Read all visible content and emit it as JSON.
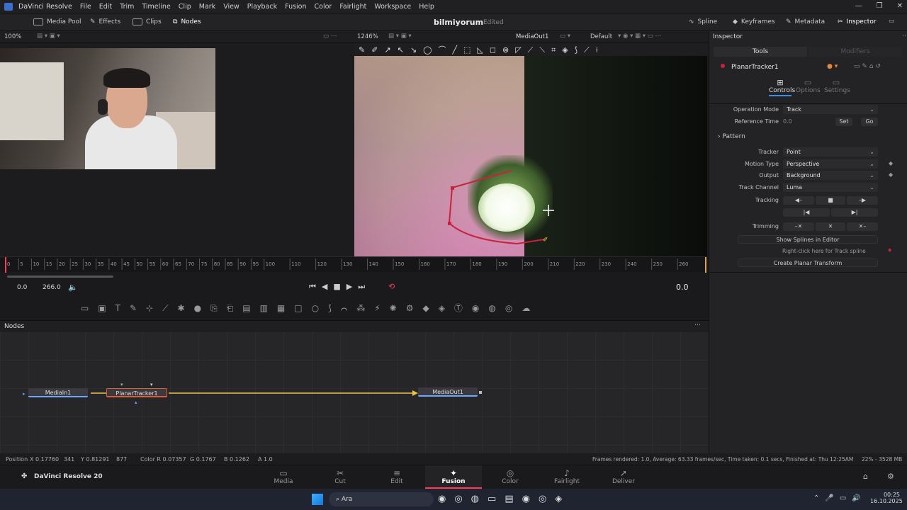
{
  "app": {
    "title": "DaVinci Resolve",
    "menu": [
      "File",
      "Edit",
      "Trim",
      "Timeline",
      "Clip",
      "Mark",
      "View",
      "Playback",
      "Fusion",
      "Color",
      "Fairlight",
      "Workspace",
      "Help"
    ]
  },
  "toolbar": {
    "media_pool": "Media Pool",
    "effects": "Effects",
    "clips": "Clips",
    "nodes": "Nodes",
    "project": "bilmiyorum",
    "edited": "Edited",
    "spline": "Spline",
    "keyframes": "Keyframes",
    "metadata": "Metadata",
    "inspector": "Inspector"
  },
  "viewer": {
    "left_zoom": "100%",
    "right_zoom": "1246%",
    "right_name": "MediaOut1",
    "right_mode": "Default"
  },
  "timeline": {
    "ticks": [
      "0",
      "5",
      "10",
      "15",
      "20",
      "25",
      "30",
      "35",
      "40",
      "45",
      "50",
      "55",
      "60",
      "65",
      "70",
      "75",
      "80",
      "85",
      "90",
      "95",
      "100",
      "110",
      "120",
      "130",
      "140",
      "150",
      "160",
      "170",
      "180",
      "190",
      "200",
      "210",
      "220",
      "230",
      "240",
      "250",
      "260"
    ],
    "start": "0.0",
    "end": "266.0",
    "current": "0.0"
  },
  "nodes": {
    "header": "Nodes",
    "media_in": "MediaIn1",
    "tracker": "PlanarTracker1",
    "media_out": "MediaOut1"
  },
  "inspector": {
    "title": "Inspector",
    "tab_tools": "Tools",
    "tab_modifiers": "Modifiers",
    "tool_name": "PlanarTracker1",
    "subtabs": [
      "Controls",
      "Options",
      "Settings"
    ],
    "operation_mode_label": "Operation Mode",
    "operation_mode": "Track",
    "reference_time_label": "Reference Time",
    "reference_time": "0.0",
    "set": "Set",
    "go": "Go",
    "pattern": "Pattern",
    "tracker_label": "Tracker",
    "tracker": "Point",
    "motion_type_label": "Motion Type",
    "motion_type": "Perspective",
    "output_label": "Output",
    "output": "Background",
    "track_channel_label": "Track Channel",
    "track_channel": "Luma",
    "tracking_label": "Tracking",
    "trimming_label": "Trimming",
    "show_splines": "Show Splines in Editor",
    "right_click": "Right-click here for Track spline",
    "create_transform": "Create Planar Transform"
  },
  "status": {
    "position": "Position",
    "x": "X 0.17760",
    "px": "341",
    "y": "Y 0.81291",
    "py": "877",
    "r": "Color R 0.07357",
    "g": "G 0.1767",
    "b": "B 0.1262",
    "a": "A 1.0",
    "frames": "Frames rendered: 1.0,  Average: 63.33 frames/sec,  Time taken: 0.1 secs,  Finished at: Thu 12:25AM",
    "mem": "22% - 3528 MB"
  },
  "pages": {
    "brand": "DaVinci Resolve 20",
    "items": [
      "Media",
      "Cut",
      "Edit",
      "Fusion",
      "Color",
      "Fairlight",
      "Deliver"
    ],
    "icons": [
      "▭",
      "✂",
      "≡",
      "✦",
      "◎",
      "♪",
      "➚"
    ],
    "active": 3
  },
  "taskbar": {
    "search": "Ara",
    "time": "00:25",
    "date": "16.10.2025"
  },
  "colors": {
    "accent": "#ff3b5c",
    "link": "#e8c547",
    "node_border": "#e05a3a"
  }
}
